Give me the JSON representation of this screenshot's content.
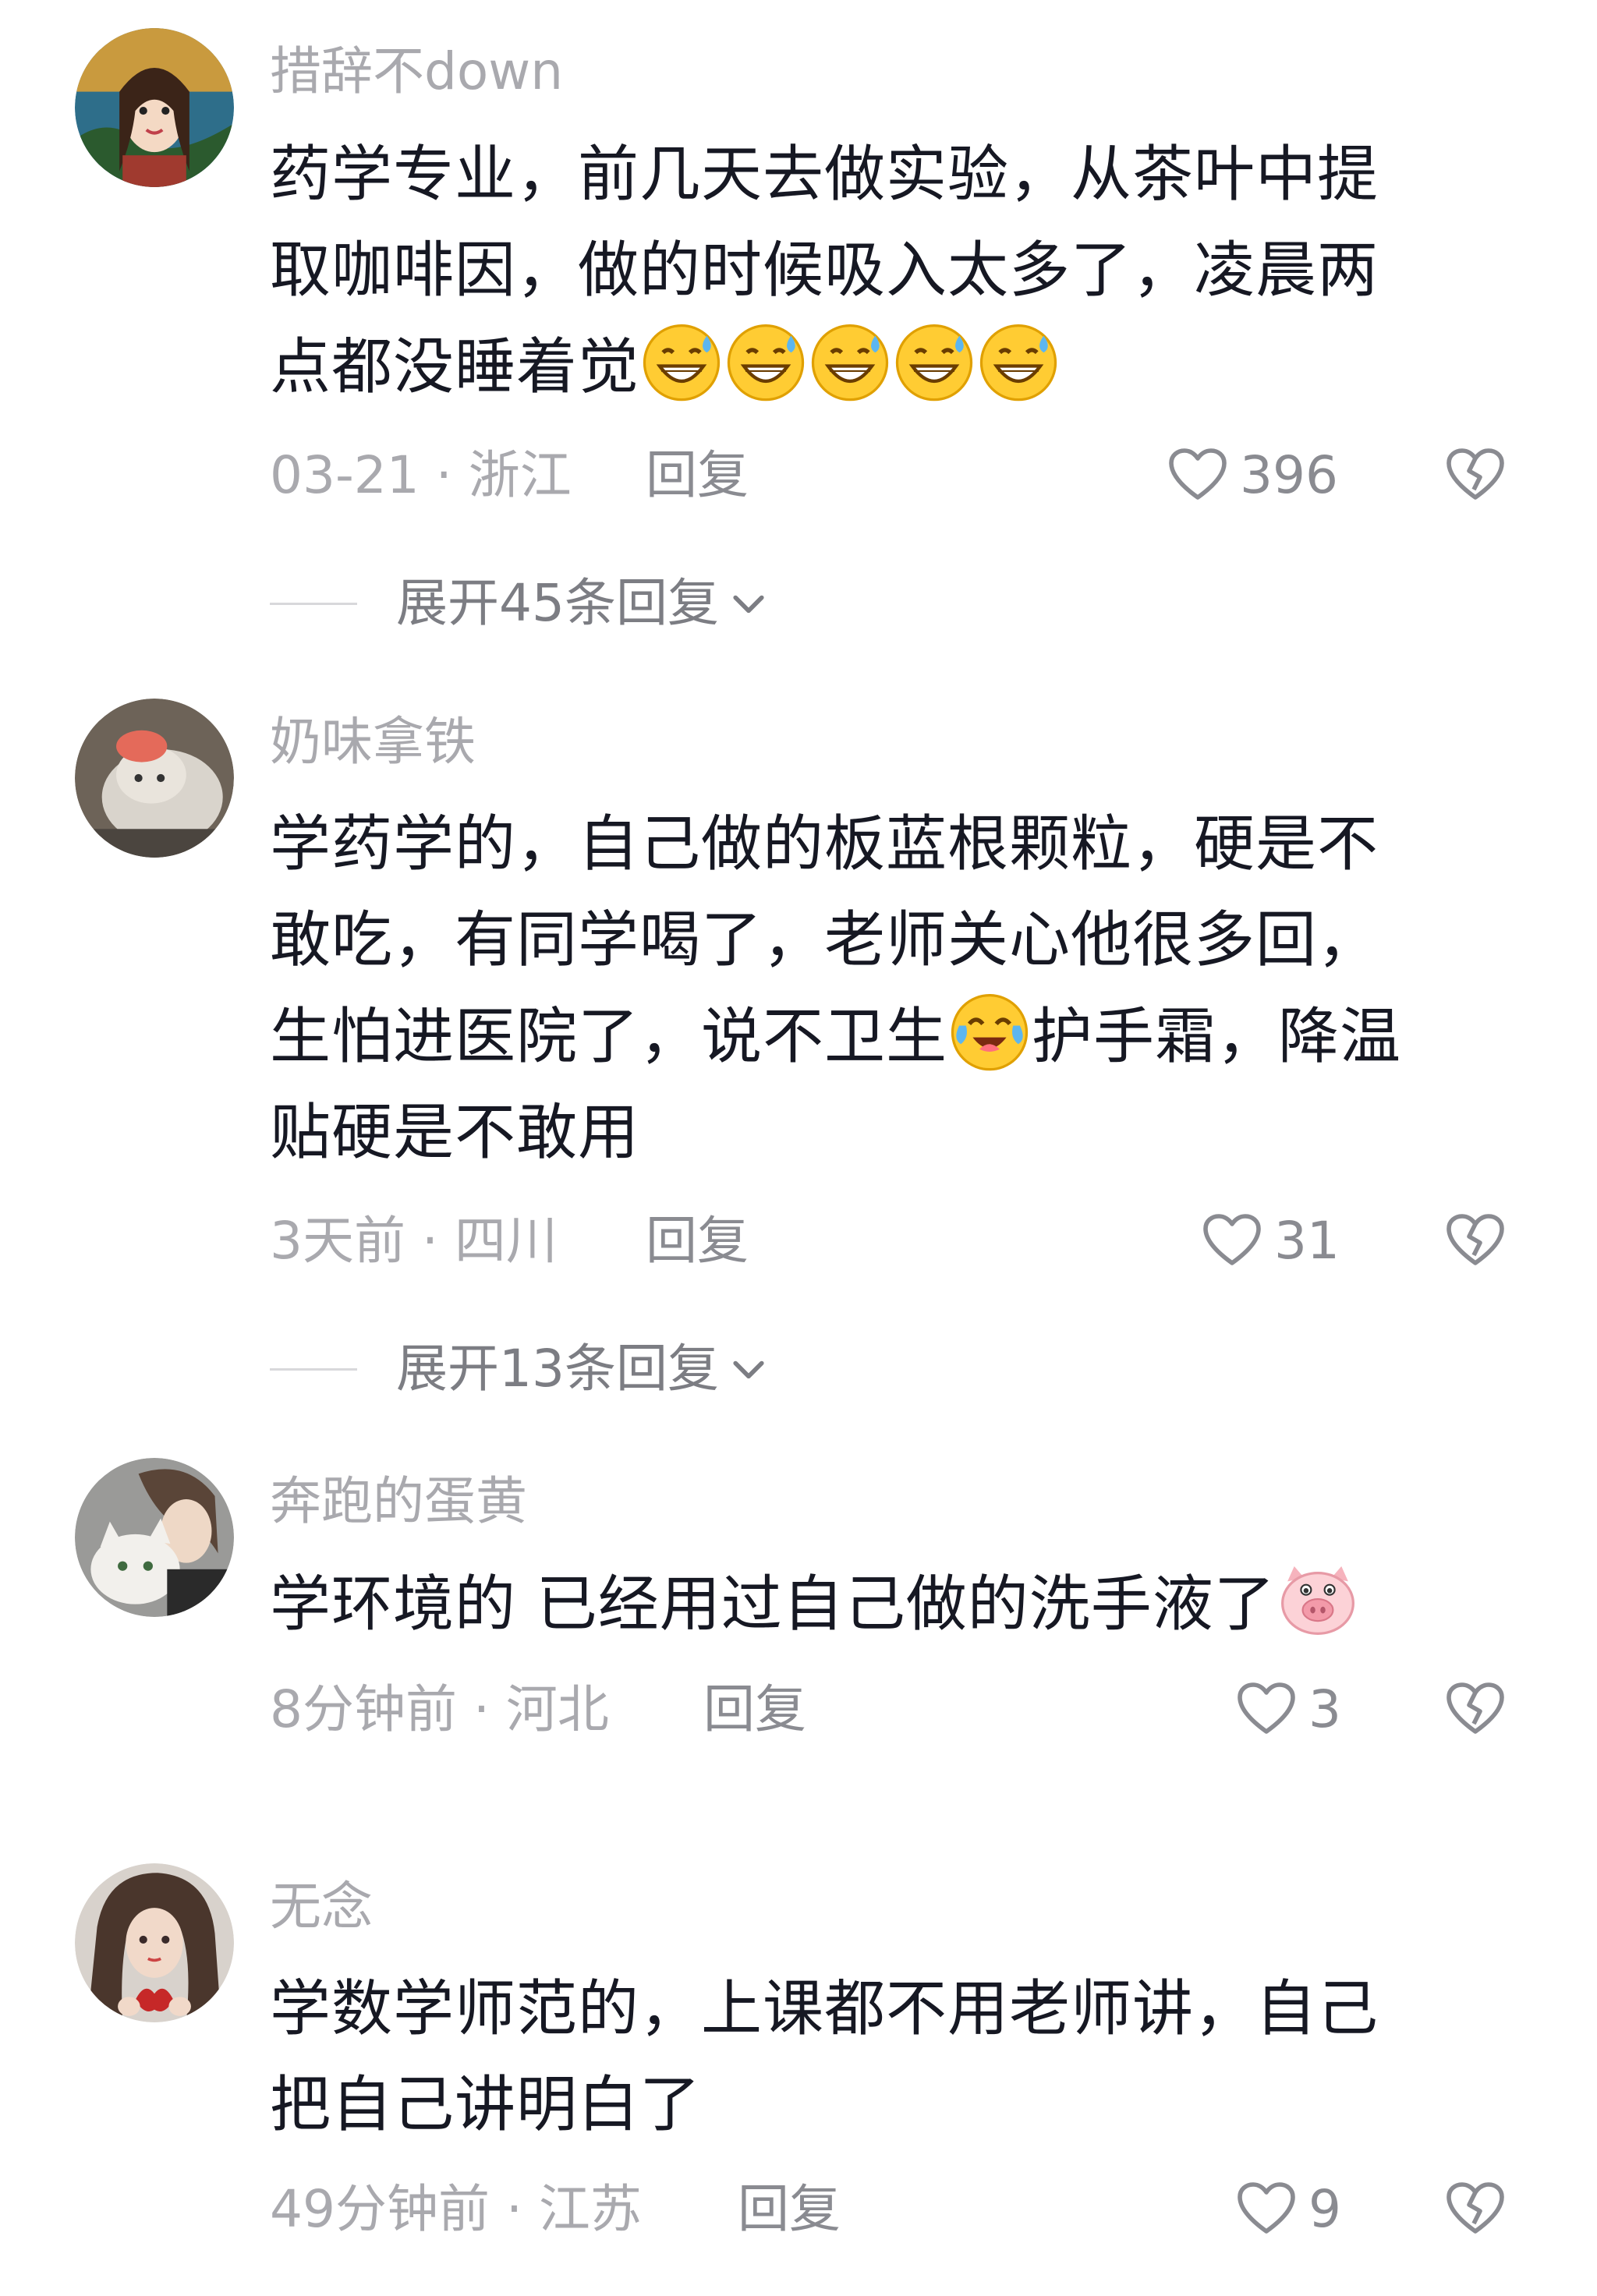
{
  "comments": [
    {
      "username": "措辞不down",
      "lines": [
        "药学专业，前几天去做实验，从茶叶中提",
        "取咖啡因，做的时候吸入太多了，凌晨两",
        "点都没睡着觉"
      ],
      "emojis": [
        "sweat-grin-emoji",
        "sweat-grin-emoji",
        "sweat-grin-emoji",
        "sweat-grin-emoji",
        "sweat-grin-emoji"
      ],
      "meta": "03-21 · 浙江",
      "reply_label": "回复",
      "likes": "396",
      "expand_label": "展开45条回复"
    },
    {
      "username": "奶味拿铁",
      "lines": [
        "学药学的，自己做的板蓝根颗粒，硬是不",
        "敢吃，有同学喝了，老师关心他很多回，",
        "生怕进医院了，说不卫生",
        "护手霜，降温",
        "贴硬是不敢用"
      ],
      "emojis": [
        "laugh-cry-emoji"
      ],
      "meta": "3天前 · 四川",
      "reply_label": "回复",
      "likes": "31",
      "expand_label": "展开13条回复"
    },
    {
      "username": "奔跑的蛋黄",
      "lines": [
        "学环境的 已经用过自己做的洗手液了"
      ],
      "emojis": [
        "pig-face-emoji"
      ],
      "meta": "8分钟前 · 河北",
      "reply_label": "回复",
      "likes": "3"
    },
    {
      "username": "无念",
      "lines": [
        "学数学师范的，上课都不用老师讲，自己",
        "把自己讲明白了"
      ],
      "meta": "49分钟前 · 江苏",
      "reply_label": "回复",
      "likes": "9"
    }
  ],
  "icons": {
    "like": "heart-outline-icon",
    "dislike": "broken-heart-icon",
    "expand": "chevron-down-icon"
  },
  "colors": {
    "text": "#161823",
    "muted": "#a9a9ae",
    "secondary": "#8a8b91",
    "divider": "#d8d8db"
  }
}
